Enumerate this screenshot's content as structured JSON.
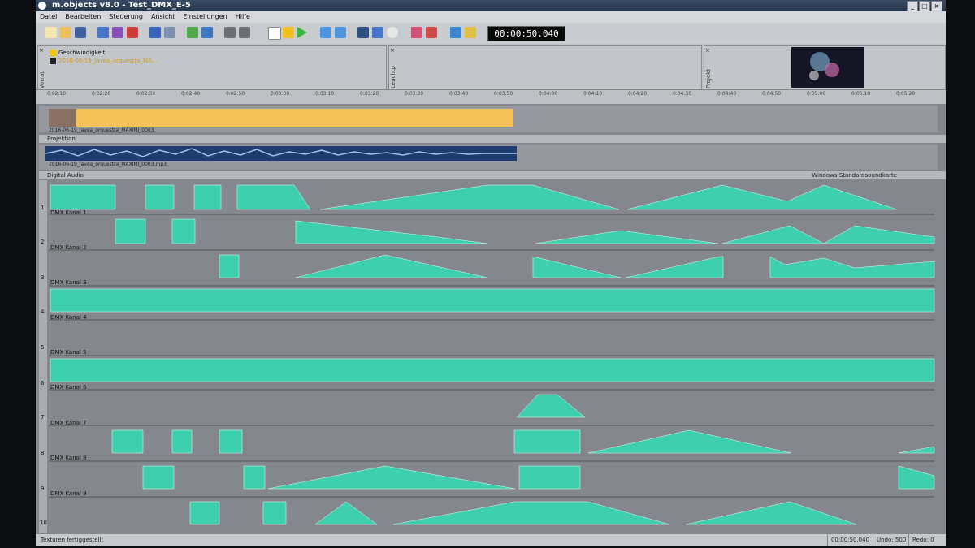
{
  "window": {
    "title": "m.objects v8.0 - Test_DMX_E-5"
  },
  "menu": [
    "Datei",
    "Bearbeiten",
    "Steuerung",
    "Ansicht",
    "Einstellungen",
    "Hilfe"
  ],
  "toolbar": {
    "time_display": "00:00:50.040"
  },
  "panes": {
    "left": {
      "label": "Vorrat",
      "items": [
        "Geschwindigkeit",
        "2016-06-19_Javea_orquestra_MA..."
      ]
    },
    "middle": {
      "label": "Leuchtp"
    },
    "right": {
      "label": "Projekt"
    }
  },
  "ruler": {
    "ticks": [
      "0:02:10",
      "0:02:20",
      "0:02:30",
      "0:02:40",
      "0:02:50",
      "0:03:00",
      "0:03:10",
      "0:03:20",
      "0:03:30",
      "0:03:40",
      "0:03:50",
      "0:04:00",
      "0:04:10",
      "0:04:20",
      "0:04:30",
      "0:04:40",
      "0:04:50",
      "0:05:00",
      "0:05:10",
      "0:05:20"
    ]
  },
  "tracks": {
    "image_caption": "2016-06-19_Javea_orquestra_MAXIMI_0003",
    "projektion_label": "Projektion",
    "audio_caption": "2016-06-19_Javea_orquestra_MAXIMI_0003.mp3",
    "digital_audio_label": "Digital Audio",
    "soundcard_label": "Windows Standardsoundkarte",
    "dmx": [
      {
        "num": "1",
        "name": "DMX Kanal 1"
      },
      {
        "num": "2",
        "name": "DMX Kanal 2"
      },
      {
        "num": "3",
        "name": "DMX Kanal 3"
      },
      {
        "num": "4",
        "name": "DMX Kanal 4"
      },
      {
        "num": "5",
        "name": "DMX Kanal 5"
      },
      {
        "num": "6",
        "name": "DMX Kanal 6"
      },
      {
        "num": "7",
        "name": "DMX Kanal 7"
      },
      {
        "num": "8",
        "name": "DMX Kanal 8"
      },
      {
        "num": "9",
        "name": "DMX Kanal 9"
      },
      {
        "num": "10",
        "name": ""
      }
    ]
  },
  "status": {
    "message": "Texturen fertiggestellt",
    "time": "00:00:50.040",
    "undo": "Undo: 500",
    "redo": "Redo: 0"
  },
  "colors": {
    "envelope": "#3ecfae",
    "track_bg": "#84878d",
    "image_bar": "#f5c35a"
  }
}
